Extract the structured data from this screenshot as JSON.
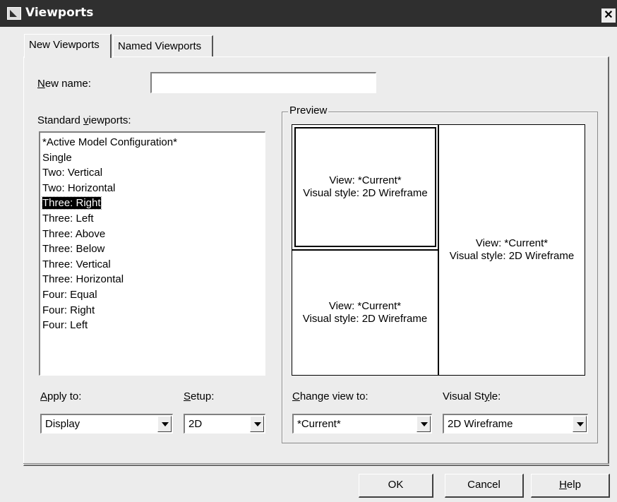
{
  "window": {
    "title": "Viewports",
    "close_glyph": "✕"
  },
  "tabs": [
    {
      "label": "New Viewports",
      "active": true
    },
    {
      "label": "Named Viewports",
      "active": false
    }
  ],
  "new_name": {
    "label_underline": "N",
    "label_rest": "ew name:",
    "value": ""
  },
  "standard_viewports": {
    "label_prefix": "Standard ",
    "label_underline": "v",
    "label_rest": "iewports:",
    "items": [
      "*Active Model Configuration*",
      "Single",
      "Two:  Vertical",
      "Two:  Horizontal",
      "Three: Right",
      "Three: Left",
      "Three: Above",
      "Three: Below",
      "Three: Vertical",
      "Three: Horizontal",
      "Four:  Equal",
      "Four:  Right",
      "Four:  Left"
    ],
    "selected_index": 4
  },
  "preview": {
    "label": "Preview",
    "viewports": [
      {
        "view": "View: *Current*",
        "style": "Visual style: 2D Wireframe"
      },
      {
        "view": "View: *Current*",
        "style": "Visual style: 2D Wireframe"
      },
      {
        "view": "View: *Current*",
        "style": "Visual style: 2D Wireframe"
      }
    ]
  },
  "apply_to": {
    "label_underline": "A",
    "label_rest": "pply to:",
    "value": "Display"
  },
  "setup": {
    "label_underline": "S",
    "label_rest": "etup:",
    "value": "2D"
  },
  "change_view": {
    "label_underline": "C",
    "label_rest": "hange view to:",
    "value": "*Current*"
  },
  "visual_style": {
    "label_prefix": "Visual St",
    "label_underline": "y",
    "label_rest": "le:",
    "value": "2D Wireframe"
  },
  "buttons": {
    "ok": "OK",
    "cancel": "Cancel",
    "help_underline": "H",
    "help_rest": "elp"
  }
}
